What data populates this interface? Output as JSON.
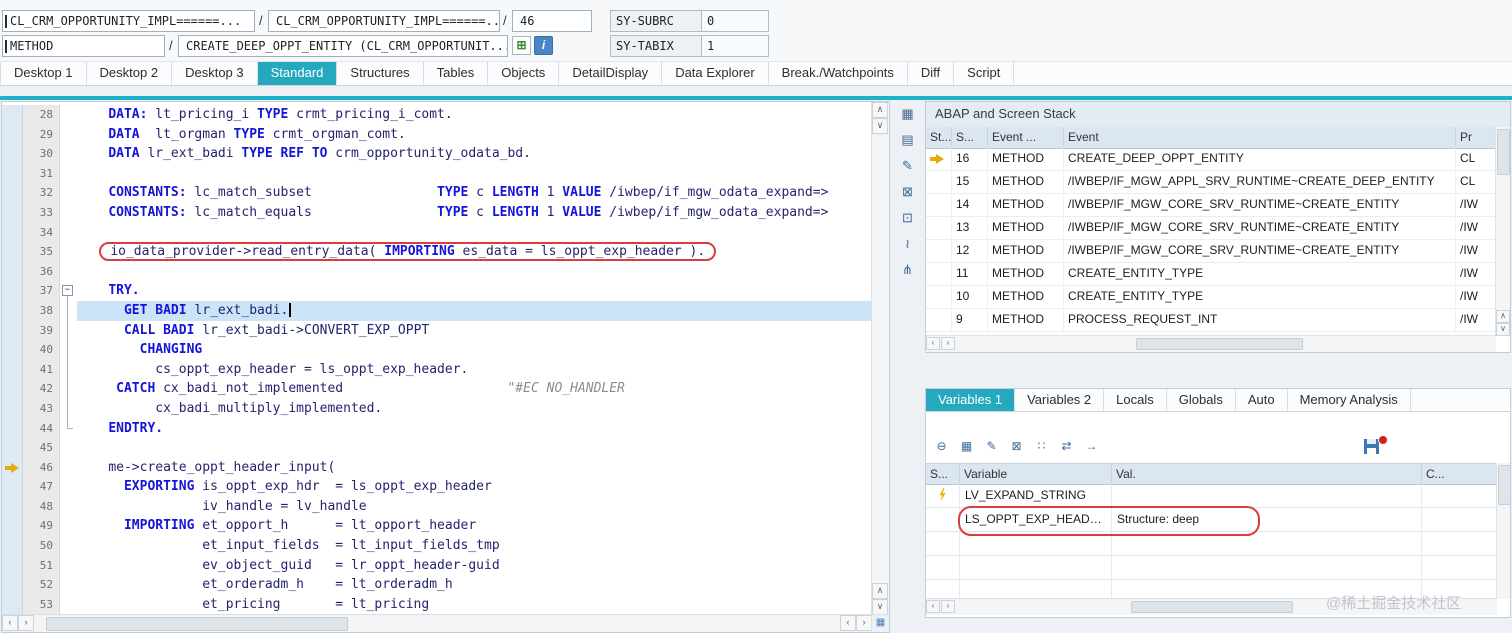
{
  "colors": {
    "accent_teal": "#26a9be",
    "keyword_blue": "#1315d8",
    "selection_blue": "#cbe4f8",
    "highlight_red": "#dd3c3c",
    "marker_yellow": "#e9a90c"
  },
  "glyphs": {
    "up": "∧",
    "down": "∨",
    "left": "‹",
    "right": "›",
    "grid": "▦",
    "collapse": "−",
    "separator": "/"
  },
  "header": {
    "main_program": "CL_CRM_OPPORTUNITY_IMPL======...",
    "include_program": "CL_CRM_OPPORTUNITY_IMPL======...",
    "line_value": "46",
    "sy_subrc_label": "SY-SUBRC",
    "sy_subrc_value": "0",
    "event_type": "METHOD",
    "event_name": "CREATE_DEEP_OPPT_ENTITY (CL_CRM_OPPORTUNIT...",
    "sy_tabix_label": "SY-TABIX",
    "sy_tabix_value": "1",
    "structure_btn_glyph": "⊞",
    "info_btn_glyph": "i"
  },
  "desktop_tabs": {
    "active": "Standard",
    "items": [
      "Desktop 1",
      "Desktop 2",
      "Desktop 3",
      "Standard",
      "Structures",
      "Tables",
      "Objects",
      "DetailDisplay",
      "Data Explorer",
      "Break./Watchpoints",
      "Diff",
      "Script"
    ]
  },
  "editor_tools": [
    {
      "name": "table-view-icon",
      "glyph": "▦"
    },
    {
      "name": "new-tool-icon",
      "glyph": "▤"
    },
    {
      "name": "edit-layout-icon",
      "glyph": "✎"
    },
    {
      "name": "close-tool-icon",
      "glyph": "⊠"
    },
    {
      "name": "maximize-tool-icon",
      "glyph": "⊡"
    },
    {
      "name": "link-tool-icon",
      "glyph": "≀"
    },
    {
      "name": "services-tool-icon",
      "glyph": "⋔"
    }
  ],
  "editor": {
    "lines": [
      {
        "n": 28,
        "indent": 4,
        "tokens": [
          [
            "kw",
            "DATA:"
          ],
          [
            "id",
            " lt_pricing_i "
          ],
          [
            "kw",
            "TYPE"
          ],
          [
            "id",
            " crmt_pricing_i_comt."
          ]
        ]
      },
      {
        "n": 29,
        "indent": 4,
        "tokens": [
          [
            "kw",
            "DATA"
          ],
          [
            "id",
            "  lt_orgman "
          ],
          [
            "kw",
            "TYPE"
          ],
          [
            "id",
            " crmt_orgman_comt."
          ]
        ]
      },
      {
        "n": 30,
        "indent": 4,
        "tokens": [
          [
            "kw",
            "DATA"
          ],
          [
            "id",
            " lr_ext_badi "
          ],
          [
            "kw",
            "TYPE REF TO"
          ],
          [
            "id",
            " crm_opportunity_odata_bd."
          ]
        ]
      },
      {
        "n": 31,
        "indent": 0,
        "tokens": []
      },
      {
        "n": 32,
        "indent": 4,
        "tokens": [
          [
            "kw",
            "CONSTANTS:"
          ],
          [
            "id",
            " lc_match_subset                "
          ],
          [
            "kw",
            "TYPE"
          ],
          [
            "id",
            " c "
          ],
          [
            "kw",
            "LENGTH"
          ],
          [
            "id",
            " 1 "
          ],
          [
            "kw",
            "VALUE"
          ],
          [
            "id",
            " /iwbep/if_mgw_odata_expand=>"
          ]
        ]
      },
      {
        "n": 33,
        "indent": 4,
        "tokens": [
          [
            "kw",
            "CONSTANTS:"
          ],
          [
            "id",
            " lc_match_equals                "
          ],
          [
            "kw",
            "TYPE"
          ],
          [
            "id",
            " c "
          ],
          [
            "kw",
            "LENGTH"
          ],
          [
            "id",
            " 1 "
          ],
          [
            "kw",
            "VALUE"
          ],
          [
            "id",
            " /iwbep/if_mgw_odata_expand=>"
          ]
        ]
      },
      {
        "n": 34,
        "indent": 0,
        "tokens": []
      },
      {
        "n": 35,
        "indent": 4,
        "circled": true,
        "tokens": [
          [
            "id",
            "io_data_provider->read_entry_data( "
          ],
          [
            "kw",
            "IMPORTING"
          ],
          [
            "id",
            " es_data = ls_oppt_exp_header )."
          ]
        ]
      },
      {
        "n": 36,
        "indent": 0,
        "tokens": []
      },
      {
        "n": 37,
        "indent": 4,
        "fold": "start",
        "tokens": [
          [
            "kw",
            "TRY."
          ]
        ]
      },
      {
        "n": 38,
        "indent": 6,
        "fold": "mid",
        "selected": true,
        "caret": true,
        "tokens": [
          [
            "kw",
            "GET BADI"
          ],
          [
            "id",
            " lr_ext_badi."
          ]
        ]
      },
      {
        "n": 39,
        "indent": 6,
        "fold": "mid",
        "tokens": [
          [
            "kw",
            "CALL BADI"
          ],
          [
            "id",
            " lr_ext_badi->CONVERT_EXP_OPPT"
          ]
        ]
      },
      {
        "n": 40,
        "indent": 8,
        "fold": "mid",
        "tokens": [
          [
            "kw",
            "CHANGING"
          ]
        ]
      },
      {
        "n": 41,
        "indent": 10,
        "fold": "mid",
        "tokens": [
          [
            "id",
            "cs_oppt_exp_header = ls_oppt_exp_header."
          ]
        ]
      },
      {
        "n": 42,
        "indent": 5,
        "fold": "mid",
        "tokens": [
          [
            "kw",
            "CATCH"
          ],
          [
            "id",
            " cx_badi_not_implemented                     "
          ],
          [
            "cm",
            "\"#EC NO_HANDLER"
          ]
        ]
      },
      {
        "n": 43,
        "indent": 10,
        "fold": "mid",
        "tokens": [
          [
            "id",
            "cx_badi_multiply_implemented."
          ]
        ]
      },
      {
        "n": 44,
        "indent": 4,
        "fold": "end",
        "tokens": [
          [
            "kw",
            "ENDTRY."
          ]
        ]
      },
      {
        "n": 45,
        "indent": 0,
        "tokens": []
      },
      {
        "n": 46,
        "indent": 4,
        "marker": true,
        "tokens": [
          [
            "id",
            "me->create_oppt_header_input("
          ]
        ]
      },
      {
        "n": 47,
        "indent": 6,
        "tokens": [
          [
            "kw",
            "EXPORTING"
          ],
          [
            "id",
            " is_oppt_exp_hdr  = ls_oppt_exp_header"
          ]
        ]
      },
      {
        "n": 48,
        "indent": 16,
        "tokens": [
          [
            "id",
            "iv_handle = lv_handle"
          ]
        ]
      },
      {
        "n": 49,
        "indent": 6,
        "tokens": [
          [
            "kw",
            "IMPORTING"
          ],
          [
            "id",
            " et_opport_h      = lt_opport_header"
          ]
        ]
      },
      {
        "n": 50,
        "indent": 16,
        "tokens": [
          [
            "id",
            "et_input_fields  = lt_input_fields_tmp"
          ]
        ]
      },
      {
        "n": 51,
        "indent": 16,
        "tokens": [
          [
            "id",
            "ev_object_guid   = lr_oppt_header-guid"
          ]
        ]
      },
      {
        "n": 52,
        "indent": 16,
        "tokens": [
          [
            "id",
            "et_orderadm_h    = lt_orderadm_h"
          ]
        ]
      },
      {
        "n": 53,
        "indent": 16,
        "tokens": [
          [
            "id",
            "et_pricing       = lt_pricing"
          ]
        ]
      }
    ]
  },
  "stack_panel": {
    "title": "ABAP and Screen Stack",
    "columns": [
      "St...",
      "S...",
      "Event ...",
      "Event",
      "Pr"
    ],
    "rows": [
      {
        "current": true,
        "level": "16",
        "event_type": "METHOD",
        "event": "CREATE_DEEP_OPPT_ENTITY",
        "program": "CL"
      },
      {
        "current": false,
        "level": "15",
        "event_type": "METHOD",
        "event": "/IWBEP/IF_MGW_APPL_SRV_RUNTIME~CREATE_DEEP_ENTITY",
        "program": "CL"
      },
      {
        "current": false,
        "level": "14",
        "event_type": "METHOD",
        "event": "/IWBEP/IF_MGW_CORE_SRV_RUNTIME~CREATE_ENTITY",
        "program": "/IW"
      },
      {
        "current": false,
        "level": "13",
        "event_type": "METHOD",
        "event": "/IWBEP/IF_MGW_CORE_SRV_RUNTIME~CREATE_ENTITY",
        "program": "/IW"
      },
      {
        "current": false,
        "level": "12",
        "event_type": "METHOD",
        "event": "/IWBEP/IF_MGW_CORE_SRV_RUNTIME~CREATE_ENTITY",
        "program": "/IW"
      },
      {
        "current": false,
        "level": "11",
        "event_type": "METHOD",
        "event": "CREATE_ENTITY_TYPE",
        "program": "/IW"
      },
      {
        "current": false,
        "level": "10",
        "event_type": "METHOD",
        "event": "CREATE_ENTITY_TYPE",
        "program": "/IW"
      },
      {
        "current": false,
        "level": "9",
        "event_type": "METHOD",
        "event": "PROCESS_REQUEST_INT",
        "program": "/IW"
      }
    ]
  },
  "variables_panel": {
    "tabs": {
      "active": "Variables 1",
      "items": [
        "Variables 1",
        "Variables 2",
        "Locals",
        "Globals",
        "Auto",
        "Memory Analysis"
      ]
    },
    "toolbar": [
      {
        "name": "delete-row-icon",
        "glyph": "⊖"
      },
      {
        "name": "edit-table-icon",
        "glyph": "▦"
      },
      {
        "name": "edit-value-icon",
        "glyph": "✎"
      },
      {
        "name": "remove-variable-icon",
        "glyph": "⊠"
      },
      {
        "name": "insert-variables-icon",
        "glyph": "∷"
      },
      {
        "name": "compare-variables-icon",
        "glyph": "⇄"
      },
      {
        "name": "goto-variable-icon",
        "glyph": "→"
      }
    ],
    "columns": [
      "S...",
      "Variable",
      "Val.",
      "C..."
    ],
    "rows": [
      {
        "flag": "lightning",
        "variable": "LV_EXPAND_STRING",
        "value": "",
        "circled": false
      },
      {
        "flag": "",
        "variable": "LS_OPPT_EXP_HEAD…",
        "value": "Structure: deep",
        "circled": true
      },
      {
        "flag": "",
        "variable": "",
        "value": "",
        "circled": false
      },
      {
        "flag": "",
        "variable": "",
        "value": "",
        "circled": false
      },
      {
        "flag": "",
        "variable": "",
        "value": "",
        "circled": false
      }
    ]
  },
  "watermark": "@稀土掘金技术社区"
}
